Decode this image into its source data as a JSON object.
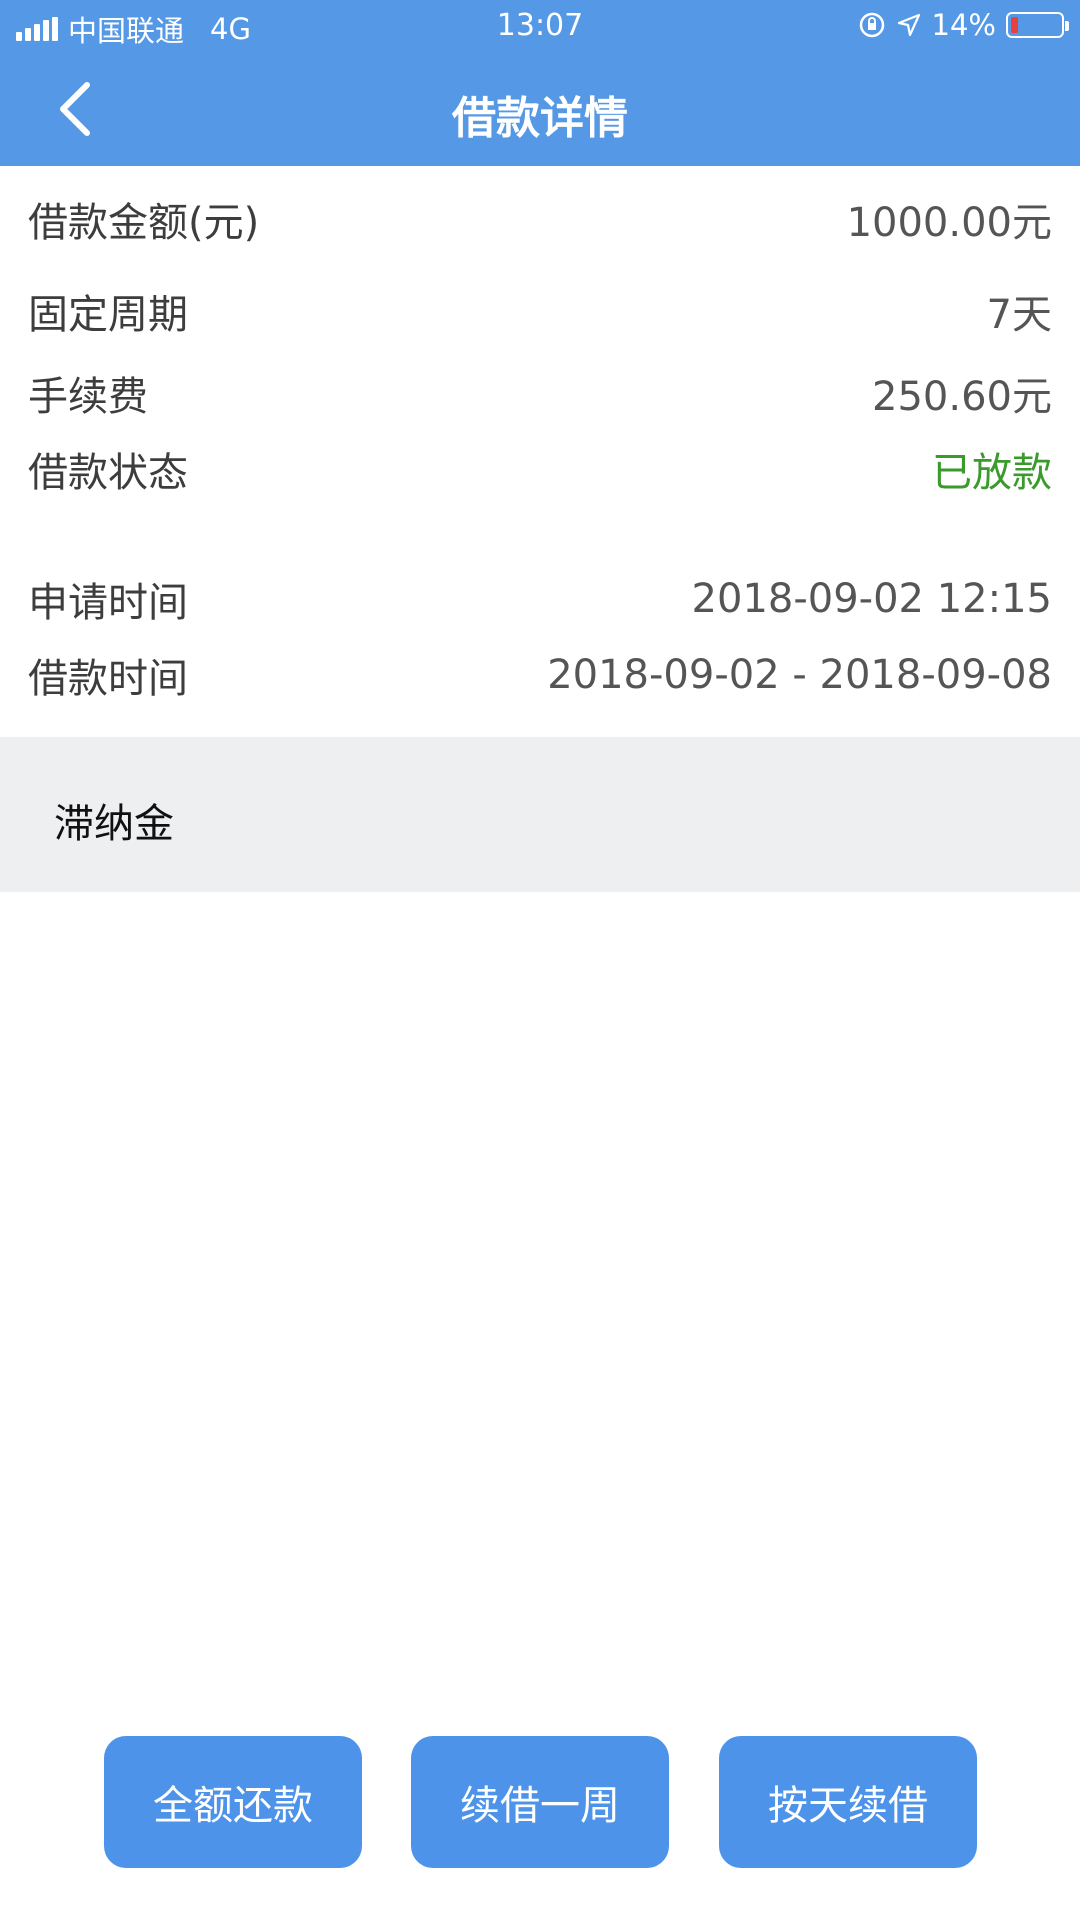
{
  "status_bar": {
    "carrier": "中国联通",
    "network": "4G",
    "time": "13:07",
    "battery_percent": "14%",
    "battery_level": 0.14,
    "battery_color": "#e8403a"
  },
  "nav": {
    "title": "借款详情",
    "back_icon": "chevron-left-icon"
  },
  "details": [
    {
      "label": "借款金额(元)",
      "value": "1000.00元"
    },
    {
      "label": "固定周期",
      "value": "7天"
    },
    {
      "label": "手续费",
      "value": "250.60元"
    },
    {
      "label": "借款状态",
      "value": "已放款",
      "value_color": "#3a9a2c"
    },
    {
      "label": "申请时间",
      "value": "2018-09-02 12:15"
    },
    {
      "label": "借款时间",
      "value": "2018-09-02 - 2018-09-08"
    }
  ],
  "late_fee": {
    "label": "滞纳金"
  },
  "actions": {
    "full_repay": "全额还款",
    "renew_week": "续借一周",
    "renew_daily": "按天续借"
  },
  "colors": {
    "header": "#5598e6",
    "button": "#4d93ea",
    "status_ok": "#3a9a2c"
  }
}
